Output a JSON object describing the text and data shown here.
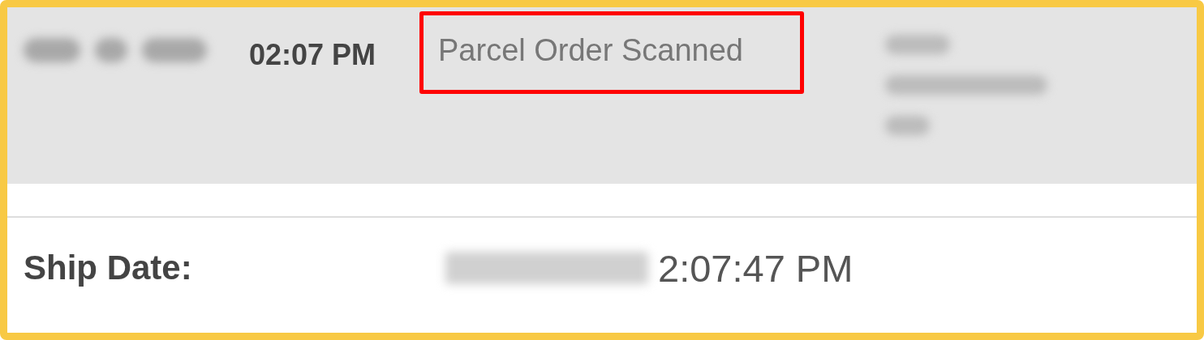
{
  "event": {
    "time": "02:07 PM",
    "description": "Parcel Order Scanned",
    "highlighted": true
  },
  "ship_date": {
    "label": "Ship Date:",
    "time": "2:07:47 PM"
  }
}
